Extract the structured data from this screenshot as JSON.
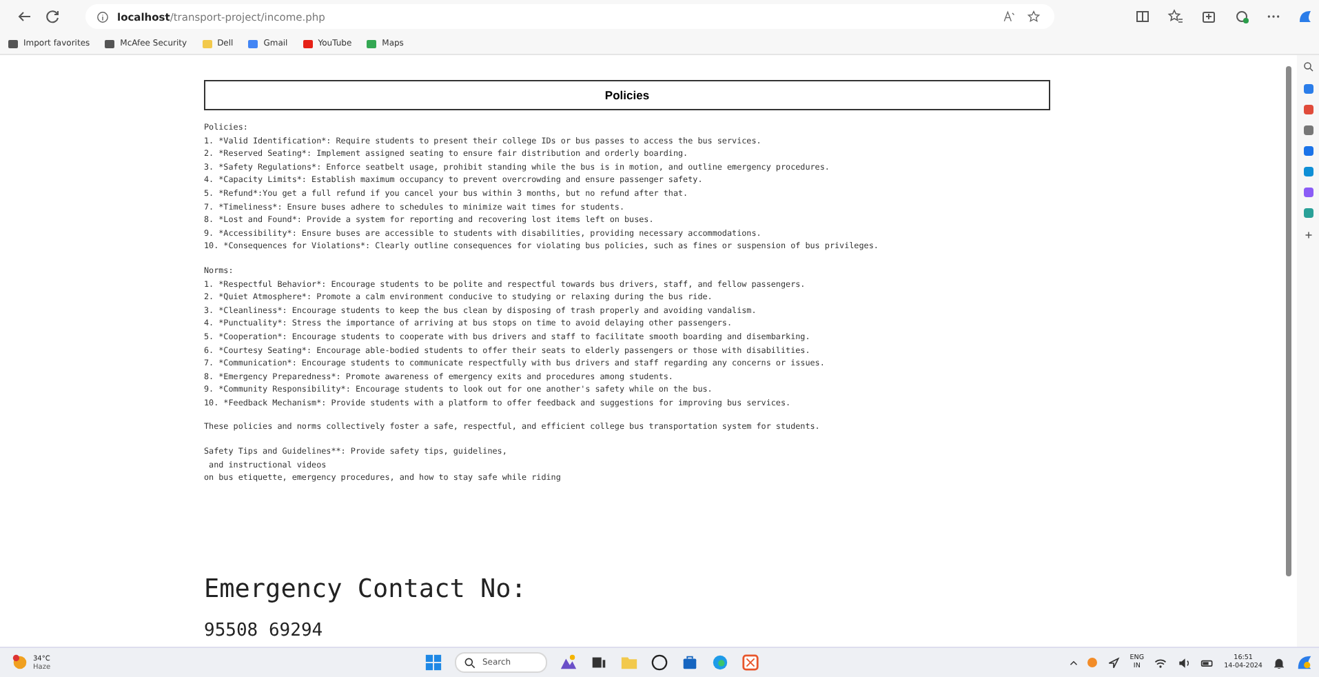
{
  "browser": {
    "url_host": "localhost",
    "url_path": "/transport-project/income.php",
    "bookmarks": [
      {
        "label": "Import favorites"
      },
      {
        "label": "McAfee Security"
      },
      {
        "label": "Dell"
      },
      {
        "label": "Gmail"
      },
      {
        "label": "YouTube"
      },
      {
        "label": "Maps"
      }
    ]
  },
  "page": {
    "heading": "Policies",
    "policies_title": "Policies:",
    "policies": [
      "1. *Valid Identification*: Require students to present their college IDs or bus passes to access the bus services.",
      "2. *Reserved Seating*: Implement assigned seating to ensure fair distribution and orderly boarding.",
      "3. *Safety Regulations*: Enforce seatbelt usage, prohibit standing while the bus is in motion, and outline emergency procedures.",
      "4. *Capacity Limits*: Establish maximum occupancy to prevent overcrowding and ensure passenger safety.",
      "5. *Refund*:You get a full refund if you cancel your bus within 3 months, but no refund after that.",
      "7. *Timeliness*: Ensure buses adhere to schedules to minimize wait times for students.",
      "8. *Lost and Found*: Provide a system for reporting and recovering lost items left on buses.",
      "9. *Accessibility*: Ensure buses are accessible to students with disabilities, providing necessary accommodations.",
      "10. *Consequences for Violations*: Clearly outline consequences for violating bus policies, such as fines or suspension of bus privileges."
    ],
    "norms_title": "Norms:",
    "norms": [
      "1. *Respectful Behavior*: Encourage students to be polite and respectful towards bus drivers, staff, and fellow passengers.",
      "2. *Quiet Atmosphere*: Promote a calm environment conducive to studying or relaxing during the bus ride.",
      "3. *Cleanliness*: Encourage students to keep the bus clean by disposing of trash properly and avoiding vandalism.",
      "4. *Punctuality*: Stress the importance of arriving at bus stops on time to avoid delaying other passengers.",
      "5. *Cooperation*: Encourage students to cooperate with bus drivers and staff to facilitate smooth boarding and disembarking.",
      "6. *Courtesy Seating*: Encourage able-bodied students to offer their seats to elderly passengers or those with disabilities.",
      "7. *Communication*: Encourage students to communicate respectfully with bus drivers and staff regarding any concerns or issues.",
      "8. *Emergency Preparedness*: Promote awareness of emergency exits and procedures among students.",
      "9. *Community Responsibility*: Encourage students to look out for one another's safety while on the bus.",
      "10. *Feedback Mechanism*: Provide students with a platform to offer feedback and suggestions for improving bus services."
    ],
    "summary": "These policies and norms collectively foster a safe, respectful, and efficient college bus transportation system for students.",
    "safety_lines": [
      "Safety Tips and Guidelines**: Provide safety tips, guidelines,",
      " and instructional videos",
      "on bus etiquette, emergency procedures, and how to stay safe while riding"
    ],
    "emergency_title": "Emergency Contact No:",
    "phone": "95508 69294"
  },
  "taskbar": {
    "temperature": "34°C",
    "weather": "Haze",
    "search_placeholder": "Search",
    "lang_top": "ENG",
    "lang_bottom": "IN",
    "time": "16:51",
    "date": "14-04-2024"
  }
}
